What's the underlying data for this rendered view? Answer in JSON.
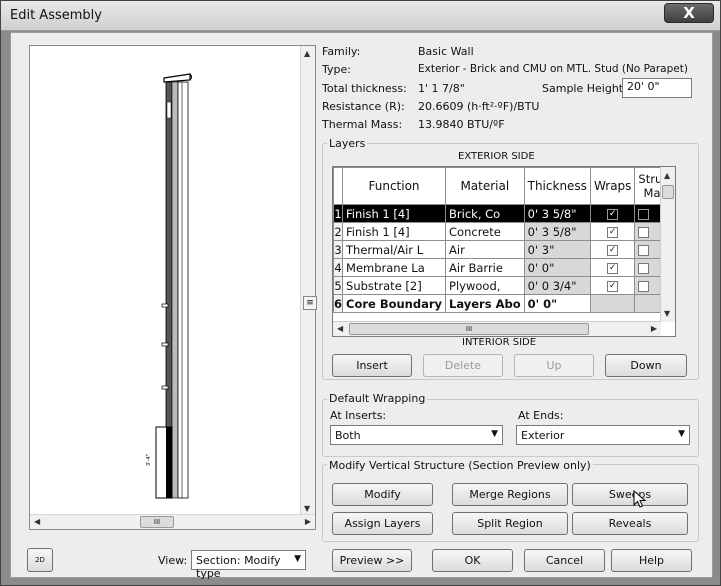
{
  "window": {
    "title": "Edit Assembly",
    "close": "X"
  },
  "props": {
    "family_label": "Family:",
    "family_value": "Basic Wall",
    "type_label": "Type:",
    "type_value": "Exterior - Brick and CMU on MTL. Stud (No Parapet)",
    "thickness_label": "Total thickness:",
    "thickness_value": "1'  1 7/8\"",
    "sample_height_label": "Sample Height:",
    "sample_height_value": "20'  0\"",
    "resistance_label": "Resistance (R):",
    "resistance_value": "20.6609 (h·ft²·ºF)/BTU",
    "mass_label": "Thermal Mass:",
    "mass_value": "13.9840 BTU/ºF"
  },
  "layers": {
    "group_title": "Layers",
    "exterior_side": "EXTERIOR SIDE",
    "interior_side": "INTERIOR SIDE",
    "columns": [
      "Function",
      "Material",
      "Thickness",
      "Wraps",
      "Structural Material"
    ],
    "scroll_mid": "III",
    "rows": [
      {
        "num": "1",
        "function": "Finish 1 [4]",
        "material": "Brick, Co",
        "thickness": "0'  3 5/8\"",
        "wraps": true,
        "structural": false
      },
      {
        "num": "2",
        "function": "Finish 1 [4]",
        "material": "Concrete",
        "thickness": "0'  3 5/8\"",
        "wraps": true,
        "structural": false
      },
      {
        "num": "3",
        "function": "Thermal/Air L",
        "material": "Air",
        "thickness": "0'  3\"",
        "wraps": true,
        "structural": false
      },
      {
        "num": "4",
        "function": "Membrane La",
        "material": "Air Barrie",
        "thickness": "0'  0\"",
        "wraps": true,
        "structural": false
      },
      {
        "num": "5",
        "function": "Substrate [2]",
        "material": "Plywood,",
        "thickness": "0'  0 3/4\"",
        "wraps": true,
        "structural": false
      },
      {
        "num": "6",
        "function": "Core Boundary",
        "material": "Layers Abo",
        "thickness": "0'  0\"",
        "wraps": null,
        "structural": null
      }
    ],
    "buttons": {
      "insert": "Insert",
      "delete": "Delete",
      "up": "Up",
      "down": "Down"
    }
  },
  "wrapping": {
    "group_title": "Default Wrapping",
    "inserts_label": "At Inserts:",
    "inserts_value": "Both",
    "ends_label": "At Ends:",
    "ends_value": "Exterior"
  },
  "vertical": {
    "group_title": "Modify Vertical Structure (Section Preview only)",
    "modify": "Modify",
    "merge": "Merge Regions",
    "sweeps": "Sweeps",
    "assign": "Assign Layers",
    "split": "Split Region",
    "reveals": "Reveals"
  },
  "preview": {
    "scroll_mid": "III",
    "splitter": "≡",
    "zoom_icon": "2D"
  },
  "footer": {
    "view_label": "View:",
    "view_value": "Section: Modify type",
    "preview_btn": "Preview >>",
    "ok": "OK",
    "cancel": "Cancel",
    "help": "Help"
  }
}
